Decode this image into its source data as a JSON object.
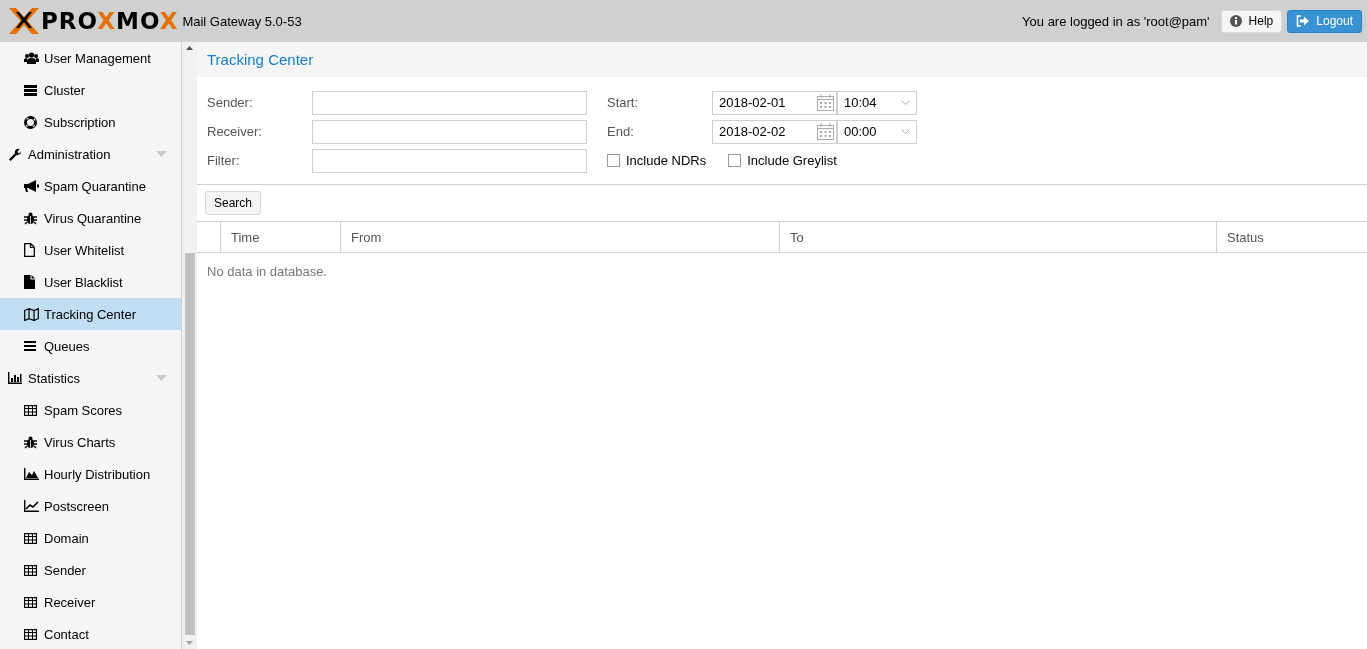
{
  "header": {
    "logo": [
      {
        "text": "PRO",
        "accent": false
      },
      {
        "text": "X",
        "accent": true
      },
      {
        "text": "MO",
        "accent": false
      },
      {
        "text": "X",
        "accent": true
      }
    ],
    "product": "Mail Gateway 5.0-53",
    "login_text": "You are logged in as 'root@pam'",
    "buttons": [
      {
        "label": "Help",
        "kind": "help"
      },
      {
        "label": "Logout",
        "kind": "logout"
      }
    ]
  },
  "sidebar": {
    "items": [
      {
        "children": [
          {
            "label": "User Management",
            "selected": false
          },
          {
            "label": "Cluster",
            "selected": false
          },
          {
            "label": "Subscription",
            "selected": false
          }
        ]
      },
      {
        "label": "Administration",
        "selected": false,
        "expanded": true,
        "children": [
          {
            "label": "Spam Quarantine",
            "selected": false
          },
          {
            "label": "Virus Quarantine",
            "selected": false
          },
          {
            "label": "User Whitelist",
            "selected": false
          },
          {
            "label": "User Blacklist",
            "selected": false
          },
          {
            "label": "Tracking Center",
            "selected": true
          },
          {
            "label": "Queues",
            "selected": false
          }
        ]
      },
      {
        "label": "Statistics",
        "selected": false,
        "expanded": true,
        "children": [
          {
            "label": "Spam Scores",
            "selected": false
          },
          {
            "label": "Virus Charts",
            "selected": false
          },
          {
            "label": "Hourly Distribution",
            "selected": false
          },
          {
            "label": "Postscreen",
            "selected": false
          },
          {
            "label": "Domain",
            "selected": false
          },
          {
            "label": "Sender",
            "selected": false
          },
          {
            "label": "Receiver",
            "selected": false
          },
          {
            "label": "Contact",
            "selected": false
          }
        ]
      }
    ]
  },
  "panel": {
    "title": "Tracking Center",
    "left_fields": [
      {
        "label": "Sender:"
      },
      {
        "label": "Receiver:"
      },
      {
        "label": "Filter:"
      }
    ],
    "date_fields": [
      {
        "label": "Start:",
        "date": "2018-02-01",
        "time": "10:04"
      },
      {
        "label": "End:",
        "date": "2018-02-02",
        "time": "00:00"
      }
    ],
    "checkboxes": [
      {
        "label": "Include NDRs",
        "checked": false
      },
      {
        "label": "Include Greylist",
        "checked": false
      }
    ],
    "search_button": "Search",
    "table": {
      "columns": [
        "Time",
        "From",
        "To",
        "Status"
      ],
      "empty_text": "No data in database."
    }
  }
}
